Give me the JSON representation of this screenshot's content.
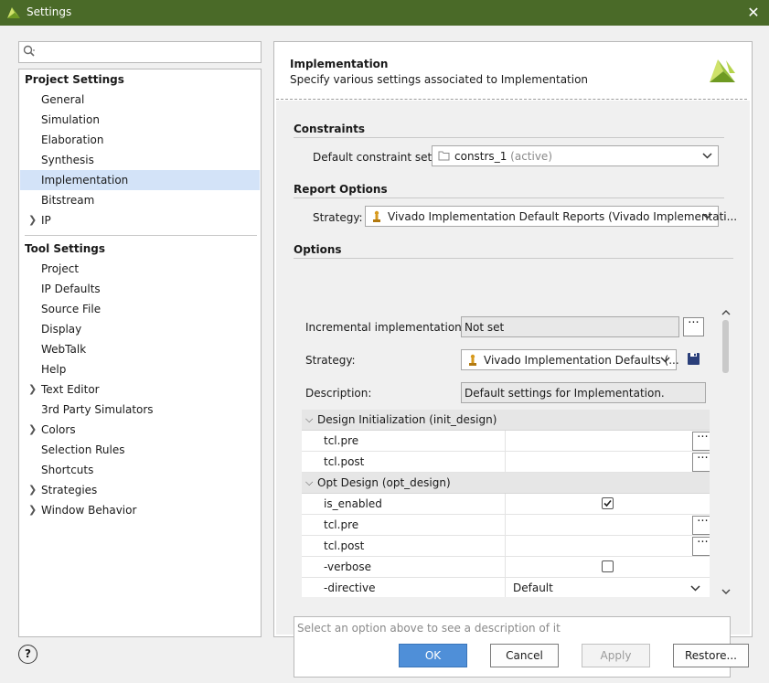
{
  "window": {
    "title": "Settings"
  },
  "search": {
    "placeholder": ""
  },
  "sidebar": {
    "project_heading": "Project Settings",
    "project_items": [
      {
        "label": "General"
      },
      {
        "label": "Simulation"
      },
      {
        "label": "Elaboration"
      },
      {
        "label": "Synthesis"
      },
      {
        "label": "Implementation",
        "selected": true
      },
      {
        "label": "Bitstream"
      },
      {
        "label": "IP",
        "expandable": true
      }
    ],
    "tool_heading": "Tool Settings",
    "tool_items": [
      {
        "label": "Project"
      },
      {
        "label": "IP Defaults"
      },
      {
        "label": "Source File"
      },
      {
        "label": "Display"
      },
      {
        "label": "WebTalk"
      },
      {
        "label": "Help"
      },
      {
        "label": "Text Editor",
        "expandable": true
      },
      {
        "label": "3rd Party Simulators"
      },
      {
        "label": "Colors",
        "expandable": true
      },
      {
        "label": "Selection Rules"
      },
      {
        "label": "Shortcuts"
      },
      {
        "label": "Strategies",
        "expandable": true
      },
      {
        "label": "Window Behavior",
        "expandable": true
      }
    ]
  },
  "header": {
    "title": "Implementation",
    "subtitle": "Specify various settings associated to Implementation"
  },
  "constraints": {
    "heading": "Constraints",
    "label": "Default constraint set:",
    "value": "constrs_1",
    "value_suffix": "(active)"
  },
  "report_options": {
    "heading": "Report Options",
    "label": "Strategy:",
    "value": "Vivado Implementation Default Reports (Vivado Implementati..."
  },
  "options": {
    "heading": "Options",
    "incremental_label": "Incremental implementation:",
    "incremental_value": "Not set",
    "strategy_label": "Strategy:",
    "strategy_value": "Vivado Implementation Defaults (...",
    "description_label": "Description:",
    "description_value": "Default settings for Implementation.",
    "groups": [
      {
        "title": "Design Initialization (init_design)",
        "rows": [
          {
            "key": "tcl.pre",
            "type": "browse"
          },
          {
            "key": "tcl.post",
            "type": "browse"
          }
        ]
      },
      {
        "title": "Opt Design (opt_design)",
        "rows": [
          {
            "key": "is_enabled",
            "type": "checkbox",
            "checked": true
          },
          {
            "key": "tcl.pre",
            "type": "browse"
          },
          {
            "key": "tcl.post",
            "type": "browse"
          },
          {
            "key": "-verbose",
            "type": "checkbox",
            "checked": false
          },
          {
            "key": "-directive",
            "type": "select",
            "value": "Default"
          }
        ]
      }
    ]
  },
  "description_box": {
    "placeholder": "Select an option above to see a description of it"
  },
  "buttons": {
    "ok": "OK",
    "cancel": "Cancel",
    "apply": "Apply",
    "restore": "Restore...",
    "help": "?"
  },
  "colors": {
    "titlebar": "#4a6a28",
    "selection": "#d3e3f8",
    "primary_button": "#4f8fd8",
    "vivado_logo": "#9ac23c"
  }
}
